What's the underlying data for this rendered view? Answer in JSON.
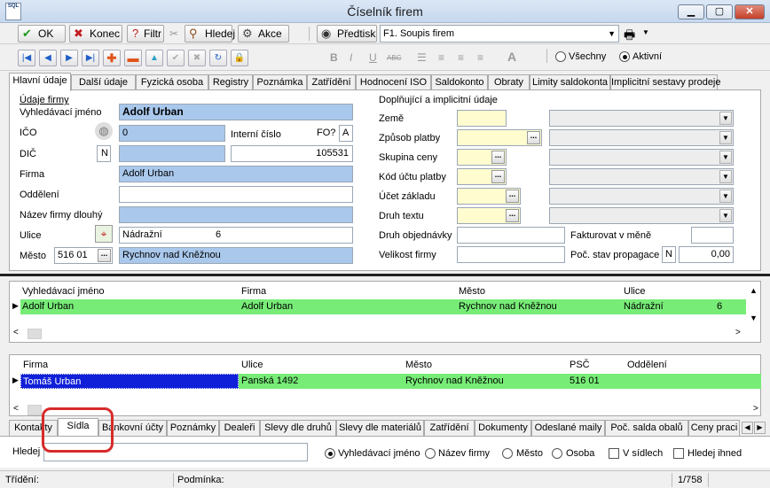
{
  "window": {
    "title": "Číselník firem",
    "logo": "SQL",
    "controls": [
      "▁",
      "▢",
      "✕"
    ]
  },
  "toolbar": {
    "ok": "OK",
    "konec": "Konec",
    "filtr": "Filtr",
    "hledej": "Hledej",
    "akce": "Akce",
    "predtisk": "Předtisk",
    "report": "F1. Soupis firem",
    "vsechny": "Všechny",
    "aktivni": "Aktivní"
  },
  "nav_icons": [
    "first-icon",
    "prev-icon",
    "next-icon",
    "last-icon",
    "add-icon",
    "delete-icon",
    "up-icon",
    "confirm-icon",
    "cancel-icon",
    "refresh-icon",
    "lock-icon"
  ],
  "format_icons": [
    "B",
    "I",
    "U",
    "ABC",
    "list",
    "align-left",
    "align-center",
    "align-right",
    "A"
  ],
  "tabs": [
    "Hlavní údaje",
    "Další údaje",
    "Fyzická osoba",
    "Registry",
    "Poznámka",
    "Zatřídění",
    "Hodnocení ISO",
    "Saldokonto",
    "Obraty",
    "Limity saldokonta",
    "Implicitní sestavy prodeje"
  ],
  "main": {
    "section_left": "Údaje firmy",
    "section_right": "Doplňující a implicitní údaje",
    "labels": {
      "vyhledavaci": "Vyhledávací jméno",
      "ico": "IČO",
      "dic": "DIČ",
      "firma": "Firma",
      "oddeleni": "Oddělení",
      "nazev_dlouhy": "Název firmy dlouhý",
      "ulice": "Ulice",
      "mesto": "Město",
      "interni": "Interní číslo",
      "fo": "FO?",
      "zeme": "Země",
      "zpusob": "Způsob platby",
      "skupina": "Skupina ceny",
      "kod_uctu": "Kód účtu platby",
      "ucet_zakladu": "Účet základu",
      "druh_textu": "Druh textu",
      "druh_obj": "Druh objednávky",
      "velikost": "Velikost firmy",
      "fakturovat": "Fakturovat v měně",
      "poc_stav": "Poč. stav propagace"
    },
    "values": {
      "vyhledavaci": "Adolf Urban",
      "ico": "0",
      "dic_flag": "N",
      "interni": "105531",
      "fo": "A",
      "firma": "Adolf Urban",
      "ulice": "Nádražní",
      "ulice_cislo": "6",
      "psc": "516 01",
      "mesto": "Rychnov nad Kněžnou",
      "poc_flag": "N",
      "poc_stav": "0,00"
    }
  },
  "grid1": {
    "headers": [
      "Vyhledávací jméno",
      "Firma",
      "Město",
      "Ulice"
    ],
    "row": [
      "Adolf Urban",
      "Adolf Urban",
      "Rychnov nad Kněžnou",
      "Nádražní",
      "6"
    ]
  },
  "grid2": {
    "headers": [
      "Firma",
      "Ulice",
      "Město",
      "PSČ",
      "Oddělení"
    ],
    "row": [
      "Tomáš Urban",
      "Panská 1492",
      "Rychnov nad Kněžnou",
      "516 01",
      ""
    ]
  },
  "bottom_tabs": [
    "Kontakty",
    "Sídla",
    "Bankovní účty",
    "Poznámky",
    "Dealeři",
    "Slevy dle druhů",
    "Slevy dle materiálů",
    "Zatřídění",
    "Dokumenty",
    "Odeslané maily",
    "Poč. salda obalů",
    "Ceny praci"
  ],
  "search": {
    "label": "Hledej",
    "options": [
      "Vyhledávací jméno",
      "Název firmy",
      "Město",
      "Osoba"
    ],
    "checks": [
      "V sídlech",
      "Hledej ihned"
    ]
  },
  "status": {
    "trideni": "Třídění:",
    "podminka": "Podmínka:",
    "count": "1/758"
  },
  "colors": {
    "selected_row": "#77ec77",
    "field_blue": "#a9c8ec",
    "field_yellow": "#fffdd0",
    "highlight": "#d72b2b"
  }
}
